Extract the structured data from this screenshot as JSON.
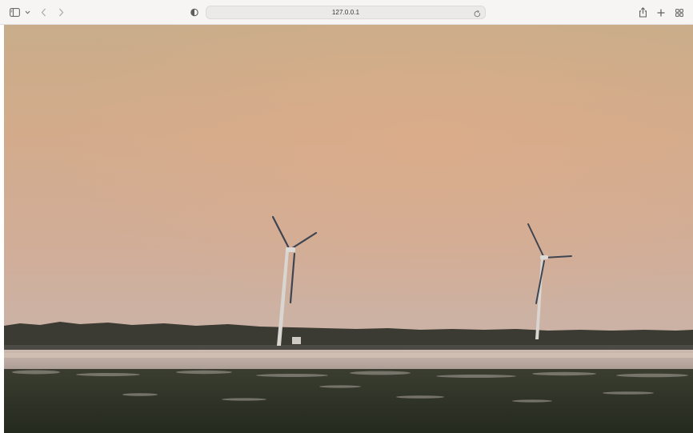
{
  "browser": {
    "address": "127.0.0.1",
    "icons": {
      "sidebar": "sidebar-icon",
      "sidebar_menu": "chevron-down-icon",
      "back": "chevron-left-icon",
      "forward": "chevron-right-icon",
      "privacy": "shield-icon",
      "reload": "reload-icon",
      "share": "share-icon",
      "new_tab": "plus-icon",
      "tab_overview": "grid-icon"
    }
  },
  "page": {
    "image": {
      "subject": "wind-turbines-at-sunset",
      "colors": {
        "sky_top": "#c9ad8a",
        "sky_mid": "#d6a98a",
        "sky_low": "#cdb0a2",
        "treeline": "#3b3a34",
        "water": "#c8b8b0",
        "ground": "#2b3124"
      }
    }
  }
}
